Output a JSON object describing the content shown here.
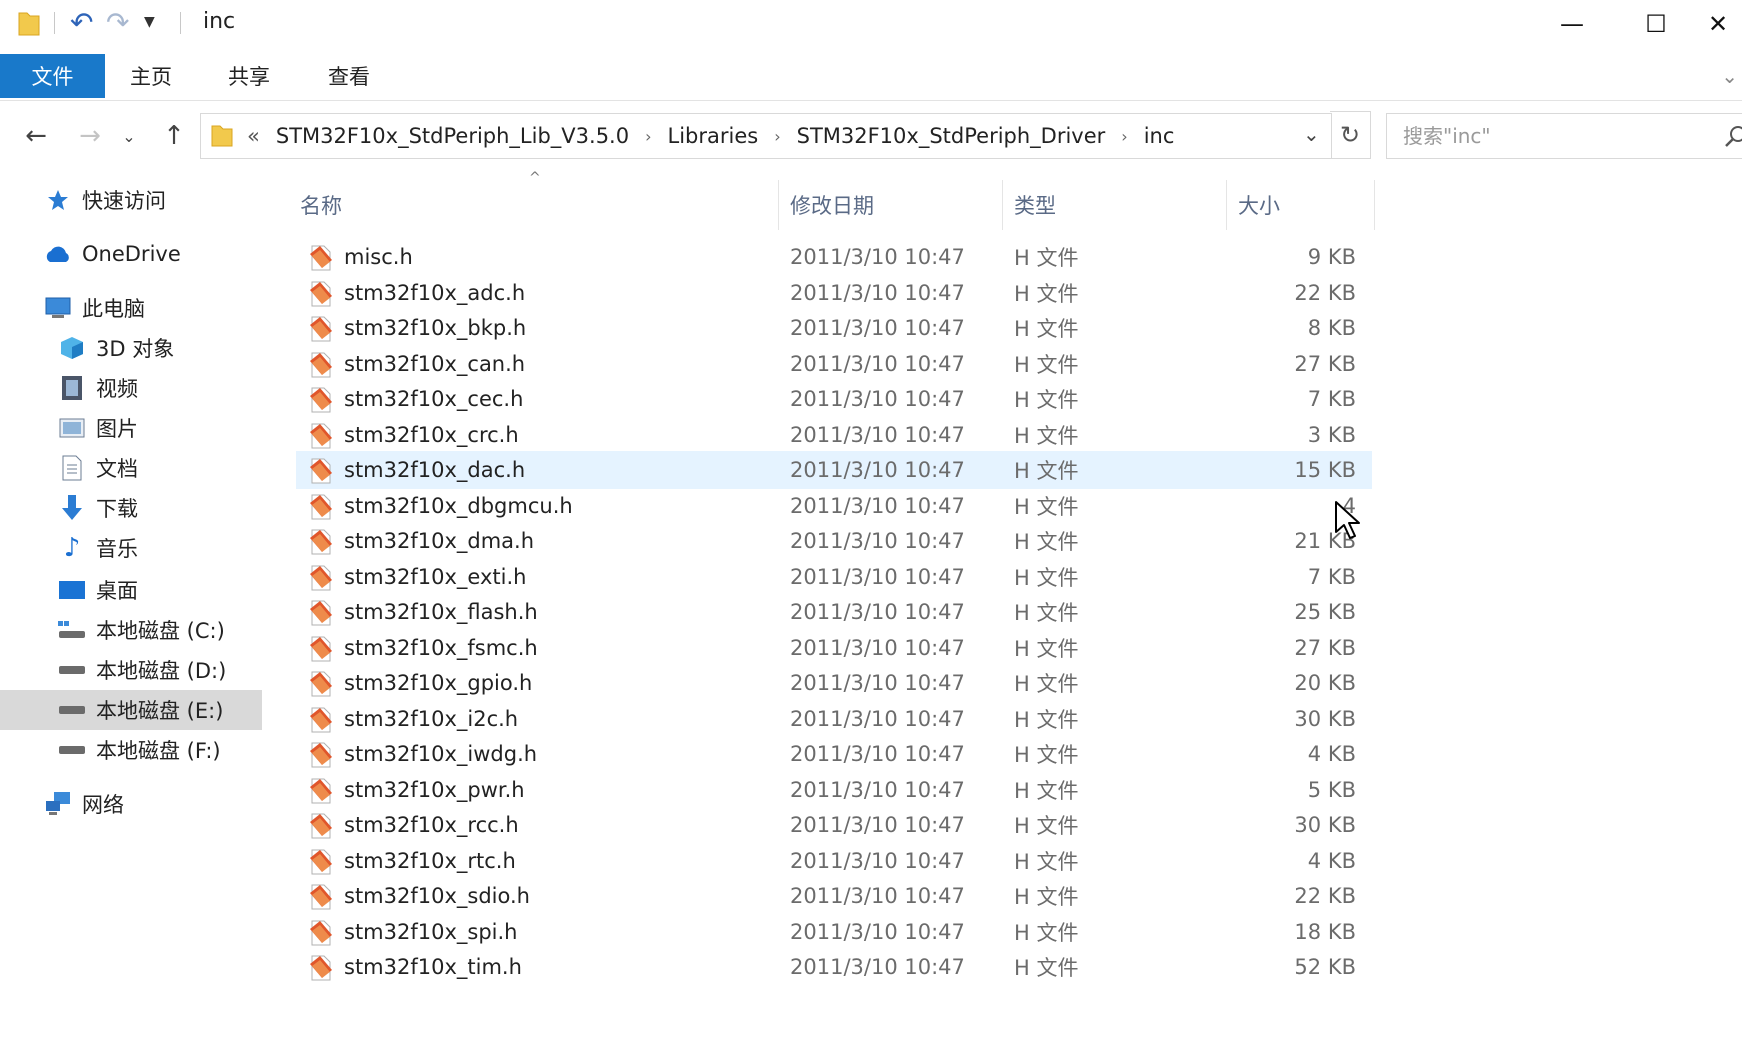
{
  "window": {
    "title": "inc",
    "minimize": "—",
    "maximize": "☐",
    "close": "✕"
  },
  "ribbon": {
    "tabs": [
      "文件",
      "主页",
      "共享",
      "查看"
    ]
  },
  "address": {
    "overflow": "«",
    "crumbs": [
      "STM32F10x_StdPeriph_Lib_V3.5.0",
      "Libraries",
      "STM32F10x_StdPeriph_Driver",
      "inc"
    ]
  },
  "search": {
    "placeholder": "搜索\"inc\""
  },
  "sidebar": {
    "items": [
      {
        "label": "快速访问",
        "icon": "star-icon"
      },
      {
        "label": "OneDrive",
        "icon": "cloud-icon"
      },
      {
        "label": "此电脑",
        "icon": "computer-icon"
      },
      {
        "label": "3D 对象",
        "icon": "cube-icon"
      },
      {
        "label": "视频",
        "icon": "film-icon"
      },
      {
        "label": "图片",
        "icon": "picture-icon"
      },
      {
        "label": "文档",
        "icon": "document-icon"
      },
      {
        "label": "下载",
        "icon": "download-icon"
      },
      {
        "label": "音乐",
        "icon": "music-icon"
      },
      {
        "label": "桌面",
        "icon": "desktop-icon"
      },
      {
        "label": "本地磁盘 (C:)",
        "icon": "system-drive-icon"
      },
      {
        "label": "本地磁盘 (D:)",
        "icon": "drive-icon"
      },
      {
        "label": "本地磁盘 (E:)",
        "icon": "drive-icon"
      },
      {
        "label": "本地磁盘 (F:)",
        "icon": "drive-icon"
      },
      {
        "label": "网络",
        "icon": "network-icon"
      }
    ],
    "selected": "本地磁盘 (E:)"
  },
  "columns": {
    "name": "名称",
    "date": "修改日期",
    "type": "类型",
    "size": "大小"
  },
  "files": [
    {
      "name": "misc.h",
      "date": "2011/3/10 10:47",
      "type": "H 文件",
      "size": "9 KB"
    },
    {
      "name": "stm32f10x_adc.h",
      "date": "2011/3/10 10:47",
      "type": "H 文件",
      "size": "22 KB"
    },
    {
      "name": "stm32f10x_bkp.h",
      "date": "2011/3/10 10:47",
      "type": "H 文件",
      "size": "8 KB"
    },
    {
      "name": "stm32f10x_can.h",
      "date": "2011/3/10 10:47",
      "type": "H 文件",
      "size": "27 KB"
    },
    {
      "name": "stm32f10x_cec.h",
      "date": "2011/3/10 10:47",
      "type": "H 文件",
      "size": "7 KB"
    },
    {
      "name": "stm32f10x_crc.h",
      "date": "2011/3/10 10:47",
      "type": "H 文件",
      "size": "3 KB"
    },
    {
      "name": "stm32f10x_dac.h",
      "date": "2011/3/10 10:47",
      "type": "H 文件",
      "size": "15 KB"
    },
    {
      "name": "stm32f10x_dbgmcu.h",
      "date": "2011/3/10 10:47",
      "type": "H 文件",
      "size": "4"
    },
    {
      "name": "stm32f10x_dma.h",
      "date": "2011/3/10 10:47",
      "type": "H 文件",
      "size": "21 KB"
    },
    {
      "name": "stm32f10x_exti.h",
      "date": "2011/3/10 10:47",
      "type": "H 文件",
      "size": "7 KB"
    },
    {
      "name": "stm32f10x_flash.h",
      "date": "2011/3/10 10:47",
      "type": "H 文件",
      "size": "25 KB"
    },
    {
      "name": "stm32f10x_fsmc.h",
      "date": "2011/3/10 10:47",
      "type": "H 文件",
      "size": "27 KB"
    },
    {
      "name": "stm32f10x_gpio.h",
      "date": "2011/3/10 10:47",
      "type": "H 文件",
      "size": "20 KB"
    },
    {
      "name": "stm32f10x_i2c.h",
      "date": "2011/3/10 10:47",
      "type": "H 文件",
      "size": "30 KB"
    },
    {
      "name": "stm32f10x_iwdg.h",
      "date": "2011/3/10 10:47",
      "type": "H 文件",
      "size": "4 KB"
    },
    {
      "name": "stm32f10x_pwr.h",
      "date": "2011/3/10 10:47",
      "type": "H 文件",
      "size": "5 KB"
    },
    {
      "name": "stm32f10x_rcc.h",
      "date": "2011/3/10 10:47",
      "type": "H 文件",
      "size": "30 KB"
    },
    {
      "name": "stm32f10x_rtc.h",
      "date": "2011/3/10 10:47",
      "type": "H 文件",
      "size": "4 KB"
    },
    {
      "name": "stm32f10x_sdio.h",
      "date": "2011/3/10 10:47",
      "type": "H 文件",
      "size": "22 KB"
    },
    {
      "name": "stm32f10x_spi.h",
      "date": "2011/3/10 10:47",
      "type": "H 文件",
      "size": "18 KB"
    },
    {
      "name": "stm32f10x_tim.h",
      "date": "2011/3/10 10:47",
      "type": "H 文件",
      "size": "52 KB"
    }
  ],
  "selected_file": "stm32f10x_dac.h",
  "colors": {
    "accent": "#1979ca",
    "selection": "#e5f3ff",
    "sidebar_selection": "#d9d9d9",
    "header_text": "#5a6a86"
  }
}
